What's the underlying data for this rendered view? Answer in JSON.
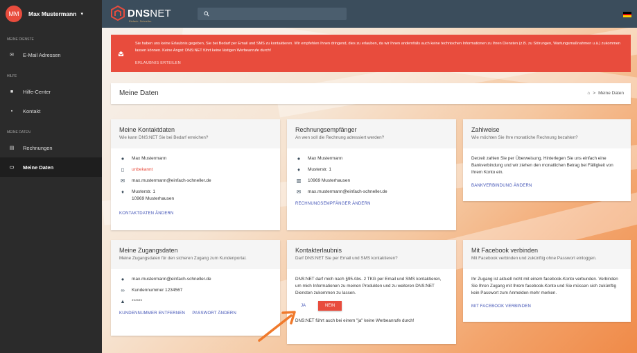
{
  "user": {
    "initials": "MM",
    "name": "Max Mustermann",
    "caret": "▾"
  },
  "logo": {
    "bold": "DNS",
    "rest": "NET",
    "tagline": "Einfach. Schneller."
  },
  "search": {
    "icon": "search-icon"
  },
  "sidebar": {
    "sections": [
      {
        "heading": "MEINE DIENSTE",
        "items": [
          {
            "label": "E-Mail Adressen",
            "icon": "mail-icon"
          }
        ]
      },
      {
        "heading": "HILFE",
        "items": [
          {
            "label": "Hilfe-Center",
            "icon": "book-icon"
          },
          {
            "label": "Kontakt",
            "icon": "chat-icon"
          }
        ]
      },
      {
        "heading": "MEINE DATEN",
        "items": [
          {
            "label": "Rechnungen",
            "icon": "invoice-icon"
          },
          {
            "label": "Meine Daten",
            "icon": "card-icon",
            "active": true
          }
        ]
      }
    ]
  },
  "alert": {
    "text": "Sie haben uns keine Erlaubnis gegeben, Sie bei Bedarf per Email und SMS zu kontaktieren. Wir empfehlen Ihnen dringend, dies zu erlauben, da wir Ihnen andernfalls auch keine technischen Informationen zu Ihren Diensten (z.B. zu Störungen, Wartungsmaßnahmen u.ä.) zukommen lassen können. Keine Angst: DNS:NET führt keine lästigen Werbeanrufe durch!",
    "link": "ERLAUBNIS ERTEILEN",
    "color": "#e84c3d"
  },
  "header": {
    "title": "Meine Daten",
    "breadcrumb_sep": ">",
    "breadcrumb_current": "Meine Daten"
  },
  "kontakt": {
    "title": "Meine Kontaktdaten",
    "subtitle": "Wie kann DNS:NET Sie bei Bedarf erreichen?",
    "name": "Max Mustermann",
    "phone": "unbekannt",
    "email": "max.mustermann@einfach-schneller.de",
    "street": "Musterstr. 1",
    "city": "10969 Musterhausen",
    "link": "KONTAKTDATEN ÄNDERN"
  },
  "rechnung": {
    "title": "Rechnungsempfänger",
    "subtitle": "An wen soll die Rechnung adressiert werden?",
    "name": "Max Mustermann",
    "street": "Musterstr. 1",
    "city": "10969 Musterhausen",
    "email": "max.mustermann@einfach-schneller.de",
    "link": "RECHNUNGSEMPFÄNGER ÄNDERN"
  },
  "zahlweise": {
    "title": "Zahlweise",
    "subtitle": "Wie möchten Sie Ihre monatliche Rechnung bezahlen?",
    "text": "Derzeit zahlen Sie per Überweisung. Hinterlegen Sie uns einfach eine Bankverbindung und wir ziehen den monatlichen Betrag bei Fälligkeit von Ihrem Konto ein.",
    "link": "BANKVERBINDUNG ÄNDERN"
  },
  "zugang": {
    "title": "Meine Zugangsdaten",
    "subtitle": "Meine Zugangsdaten für den sicheren Zugang zum Kundenportal.",
    "email": "max.mustermann@einfach-schneller.de",
    "kundennummer": "Kundennummer 1234567",
    "password": "******",
    "link1": "KUNDENNUMMER ENTFERNEN",
    "link2": "PASSWORT ÄNDERN"
  },
  "erlaubnis": {
    "title": "Kontakterlaubnis",
    "subtitle": "Darf DNS:NET Sie per Email und SMS kontaktieren?",
    "text": "DNS:NET darf mich nach §95 Abs. 2 TKG per Email und SMS kontaktieren, um mich Informationen zu meinen Produkten und zu weiteren DNS:NET Diensten zukommen zu lassen.",
    "yes": "JA",
    "no": "NEIN",
    "note": "DNS:NET führt auch bei einem \"ja\" keine Werbeanrufe durch!"
  },
  "facebook": {
    "title": "Mit Facebook verbinden",
    "subtitle": "Mit Facebook verbinden und zukünftig ohne Passwort einloggen.",
    "text": "Ihr Zugang ist aktuell nicht mit einem facebook-Konto verbunden. Verbinden Sie Ihren Zugang mit Ihrem facebook-Konto und Sie müssen sich zukünftig kein Passwort zum Anmelden mehr merken.",
    "link": "MIT FACEBOOK VERBINDEN"
  },
  "colors": {
    "accent": "#3f51b5",
    "topbar": "#3b4d5c",
    "sidebar": "#2b2b2b",
    "arrow": "#f07a2c"
  }
}
